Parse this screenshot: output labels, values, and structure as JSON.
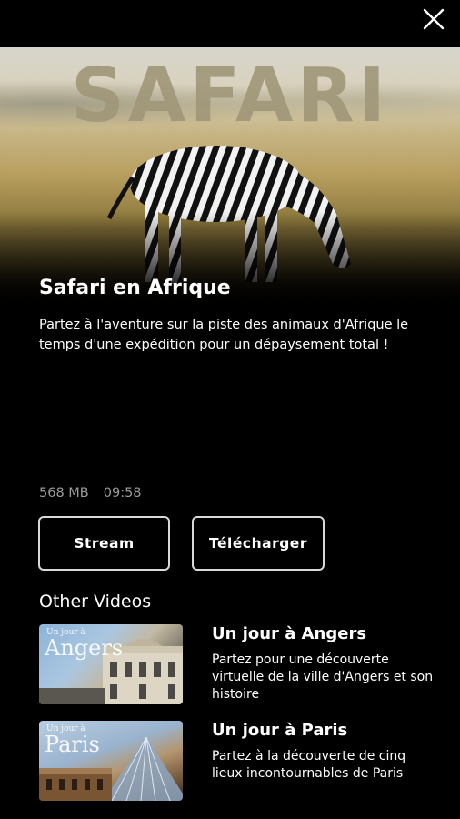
{
  "hero": {
    "overlay_title": "SAFARI"
  },
  "video": {
    "title": "Safari en Afrique",
    "description": "Partez à l'aventure sur la piste des animaux d'Afrique le temps d'une expédition pour un dépaysement total !",
    "size": "568 MB",
    "duration": "09:58"
  },
  "actions": {
    "stream_label": "Stream",
    "download_label": "Télécharger"
  },
  "other_videos": {
    "section_title": "Other Videos",
    "items": [
      {
        "thumb_kicker": "Un jour à",
        "thumb_label": "Angers",
        "title": "Un jour à Angers",
        "description": "Partez pour une découverte virtuelle de la ville d'Angers et son histoire"
      },
      {
        "thumb_kicker": "Un jour à",
        "thumb_label": "Paris",
        "title": "Un jour à Paris",
        "description": "Partez à la découverte de cinq lieux incontournables de Paris"
      }
    ]
  },
  "icons": {
    "close": "close-icon"
  },
  "colors": {
    "background": "#000000",
    "text": "#ffffff",
    "meta_text": "#9b9b9b",
    "button_border": "#d9d9d9"
  }
}
